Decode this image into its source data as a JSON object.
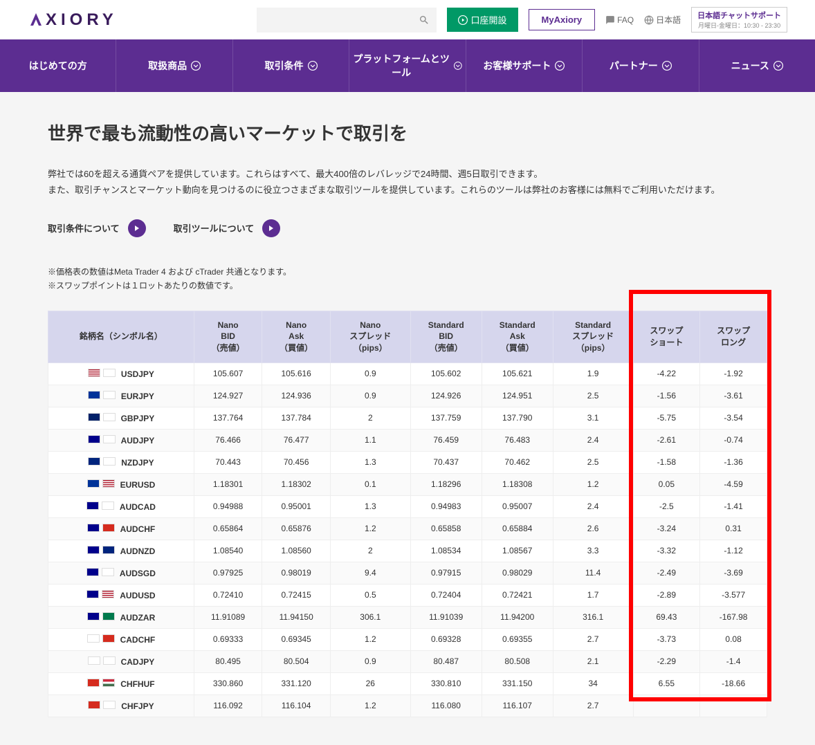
{
  "header": {
    "logo_text": "XIORY",
    "open_account": "口座開設",
    "myaxiory": "MyAxiory",
    "faq": "FAQ",
    "language": "日本語",
    "chat_title": "日本語チャットサポート",
    "chat_hours": "月曜日-金曜日：10:30 - 23:30"
  },
  "nav": [
    "はじめての方",
    "取扱商品",
    "取引条件",
    "プラットフォームとツール",
    "お客様サポート",
    "パートナー",
    "ニュース"
  ],
  "page": {
    "title": "世界で最も流動性の高いマーケットで取引を",
    "desc1": "弊社では60を超える通貨ペアを提供しています。これらはすべて、最大400倍のレバレッジで24時間、週5日取引できます。",
    "desc2": "また、取引チャンスとマーケット動向を見つけるのに役立つさまざまな取引ツールを提供しています。これらのツールは弊社のお客様には無料でご利用いただけます。",
    "link1": "取引条件について",
    "link2": "取引ツールについて",
    "note1": "※価格表の数値はMeta Trader 4 および cTrader 共通となります。",
    "note2": "※スワップポイントは１ロットあたりの数値です。"
  },
  "table": {
    "headers": {
      "symbol": "銘柄名（シンボル名）",
      "nano_bid": "Nano\nBID\n（売値）",
      "nano_ask": "Nano\nAsk\n（買値）",
      "nano_spread": "Nano\nスプレッド\n（pips）",
      "std_bid": "Standard\nBID\n（売値）",
      "std_ask": "Standard\nAsk\n（買値）",
      "std_spread": "Standard\nスプレッド\n（pips）",
      "swap_short": "スワップ\nショート",
      "swap_long": "スワップ\nロング"
    },
    "rows": [
      {
        "flags": [
          "us",
          "jp"
        ],
        "sym": "USDJPY",
        "nb": "105.607",
        "na": "105.616",
        "ns": "0.9",
        "sb": "105.602",
        "sa": "105.621",
        "ss": "1.9",
        "sws": "-4.22",
        "swl": "-1.92"
      },
      {
        "flags": [
          "eu",
          "jp"
        ],
        "sym": "EURJPY",
        "nb": "124.927",
        "na": "124.936",
        "ns": "0.9",
        "sb": "124.926",
        "sa": "124.951",
        "ss": "2.5",
        "sws": "-1.56",
        "swl": "-3.61"
      },
      {
        "flags": [
          "gb",
          "jp"
        ],
        "sym": "GBPJPY",
        "nb": "137.764",
        "na": "137.784",
        "ns": "2",
        "sb": "137.759",
        "sa": "137.790",
        "ss": "3.1",
        "sws": "-5.75",
        "swl": "-3.54"
      },
      {
        "flags": [
          "au",
          "jp"
        ],
        "sym": "AUDJPY",
        "nb": "76.466",
        "na": "76.477",
        "ns": "1.1",
        "sb": "76.459",
        "sa": "76.483",
        "ss": "2.4",
        "sws": "-2.61",
        "swl": "-0.74"
      },
      {
        "flags": [
          "nz",
          "jp"
        ],
        "sym": "NZDJPY",
        "nb": "70.443",
        "na": "70.456",
        "ns": "1.3",
        "sb": "70.437",
        "sa": "70.462",
        "ss": "2.5",
        "sws": "-1.58",
        "swl": "-1.36"
      },
      {
        "flags": [
          "eu",
          "us"
        ],
        "sym": "EURUSD",
        "nb": "1.18301",
        "na": "1.18302",
        "ns": "0.1",
        "sb": "1.18296",
        "sa": "1.18308",
        "ss": "1.2",
        "sws": "0.05",
        "swl": "-4.59"
      },
      {
        "flags": [
          "au",
          "ca"
        ],
        "sym": "AUDCAD",
        "nb": "0.94988",
        "na": "0.95001",
        "ns": "1.3",
        "sb": "0.94983",
        "sa": "0.95007",
        "ss": "2.4",
        "sws": "-2.5",
        "swl": "-1.41"
      },
      {
        "flags": [
          "au",
          "ch"
        ],
        "sym": "AUDCHF",
        "nb": "0.65864",
        "na": "0.65876",
        "ns": "1.2",
        "sb": "0.65858",
        "sa": "0.65884",
        "ss": "2.6",
        "sws": "-3.24",
        "swl": "0.31"
      },
      {
        "flags": [
          "au",
          "nz"
        ],
        "sym": "AUDNZD",
        "nb": "1.08540",
        "na": "1.08560",
        "ns": "2",
        "sb": "1.08534",
        "sa": "1.08567",
        "ss": "3.3",
        "sws": "-3.32",
        "swl": "-1.12"
      },
      {
        "flags": [
          "au",
          "sg"
        ],
        "sym": "AUDSGD",
        "nb": "0.97925",
        "na": "0.98019",
        "ns": "9.4",
        "sb": "0.97915",
        "sa": "0.98029",
        "ss": "11.4",
        "sws": "-2.49",
        "swl": "-3.69"
      },
      {
        "flags": [
          "au",
          "us"
        ],
        "sym": "AUDUSD",
        "nb": "0.72410",
        "na": "0.72415",
        "ns": "0.5",
        "sb": "0.72404",
        "sa": "0.72421",
        "ss": "1.7",
        "sws": "-2.89",
        "swl": "-3.577"
      },
      {
        "flags": [
          "au",
          "za"
        ],
        "sym": "AUDZAR",
        "nb": "11.91089",
        "na": "11.94150",
        "ns": "306.1",
        "sb": "11.91039",
        "sa": "11.94200",
        "ss": "316.1",
        "sws": "69.43",
        "swl": "-167.98"
      },
      {
        "flags": [
          "ca",
          "ch"
        ],
        "sym": "CADCHF",
        "nb": "0.69333",
        "na": "0.69345",
        "ns": "1.2",
        "sb": "0.69328",
        "sa": "0.69355",
        "ss": "2.7",
        "sws": "-3.73",
        "swl": "0.08"
      },
      {
        "flags": [
          "ca",
          "jp"
        ],
        "sym": "CADJPY",
        "nb": "80.495",
        "na": "80.504",
        "ns": "0.9",
        "sb": "80.487",
        "sa": "80.508",
        "ss": "2.1",
        "sws": "-2.29",
        "swl": "-1.4"
      },
      {
        "flags": [
          "ch",
          "hu"
        ],
        "sym": "CHFHUF",
        "nb": "330.860",
        "na": "331.120",
        "ns": "26",
        "sb": "330.810",
        "sa": "331.150",
        "ss": "34",
        "sws": "6.55",
        "swl": "-18.66"
      },
      {
        "flags": [
          "ch",
          "jp"
        ],
        "sym": "CHFJPY",
        "nb": "116.092",
        "na": "116.104",
        "ns": "1.2",
        "sb": "116.080",
        "sa": "116.107",
        "ss": "2.7",
        "sws": "",
        "swl": ""
      }
    ]
  },
  "flag_colors": {
    "us": "linear-gradient(180deg,#b22234 0 15%,#fff 15% 30%,#b22234 30% 45%,#fff 45% 60%,#b22234 60% 75%,#fff 75% 90%,#b22234 90%)",
    "jp": "#fff",
    "eu": "#003399",
    "gb": "#012169",
    "au": "#00008b",
    "nz": "#00247d",
    "ca": "#fff",
    "ch": "#d52b1e",
    "sg": "#fff",
    "za": "#007a4d",
    "hu": "linear-gradient(180deg,#cd2a3e 0 33%,#fff 33% 66%,#436f4d 66%)"
  }
}
